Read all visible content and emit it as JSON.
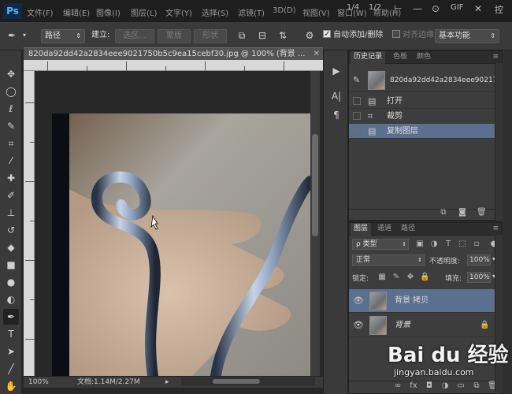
{
  "app": {
    "logo": "Ps"
  },
  "menubar": {
    "items": [
      "文件(F)",
      "编辑(E)",
      "图像(I)",
      "图层(L)",
      "文字(Y)",
      "选择(S)",
      "滤镜(T)",
      "3D(D)",
      "视图(V)",
      "窗口(W)",
      "帮助(H)"
    ],
    "pager": [
      "1/4",
      "1/2"
    ],
    "right_label": "GIF",
    "far_right": "控"
  },
  "options_bar": {
    "mode_select": "路径",
    "build_label": "建立:",
    "selection_btn": "选区...",
    "mask_btn": "蒙版",
    "shape_btn": "形状",
    "auto_add_label": "自动添加/删除",
    "auto_add_checked": true,
    "align_edges_label": "对齐边缘",
    "align_edges_checked": false,
    "workspace_select": "基本功能"
  },
  "document": {
    "tab_title": "820da92dd42a2834eee9021750b5c9ea15cebf30.jpg @ 100% (背景 ...",
    "zoom": "100%",
    "doc_info": "文档:1.14M/2.27M"
  },
  "history_panel": {
    "tabs": [
      "历史记录",
      "色板",
      "颜色"
    ],
    "snapshot_name": "820da92dd42a2834eee902175...",
    "items": [
      {
        "label": "打开",
        "icon": "document-icon"
      },
      {
        "label": "裁剪",
        "icon": "crop-icon"
      },
      {
        "label": "复制图层",
        "icon": "document-icon"
      }
    ]
  },
  "layers_panel": {
    "tabs": [
      "图层",
      "通道",
      "路径"
    ],
    "filter_select": "类型",
    "blend_mode": "正常",
    "opacity_label": "不透明度:",
    "opacity_value": "100%",
    "lock_label": "锁定:",
    "fill_label": "填充:",
    "fill_value": "100%",
    "layers": [
      {
        "name": "背景 拷贝",
        "selected": true
      },
      {
        "name": "背景",
        "selected": false,
        "locked": true
      }
    ]
  },
  "watermark": {
    "brand": "Bai du 经验",
    "url": "jingyan.baidu.com"
  },
  "colors": {
    "selection": "#5b6f8f",
    "panel": "#3d3d3d",
    "chrome": "#1e1e1e"
  }
}
